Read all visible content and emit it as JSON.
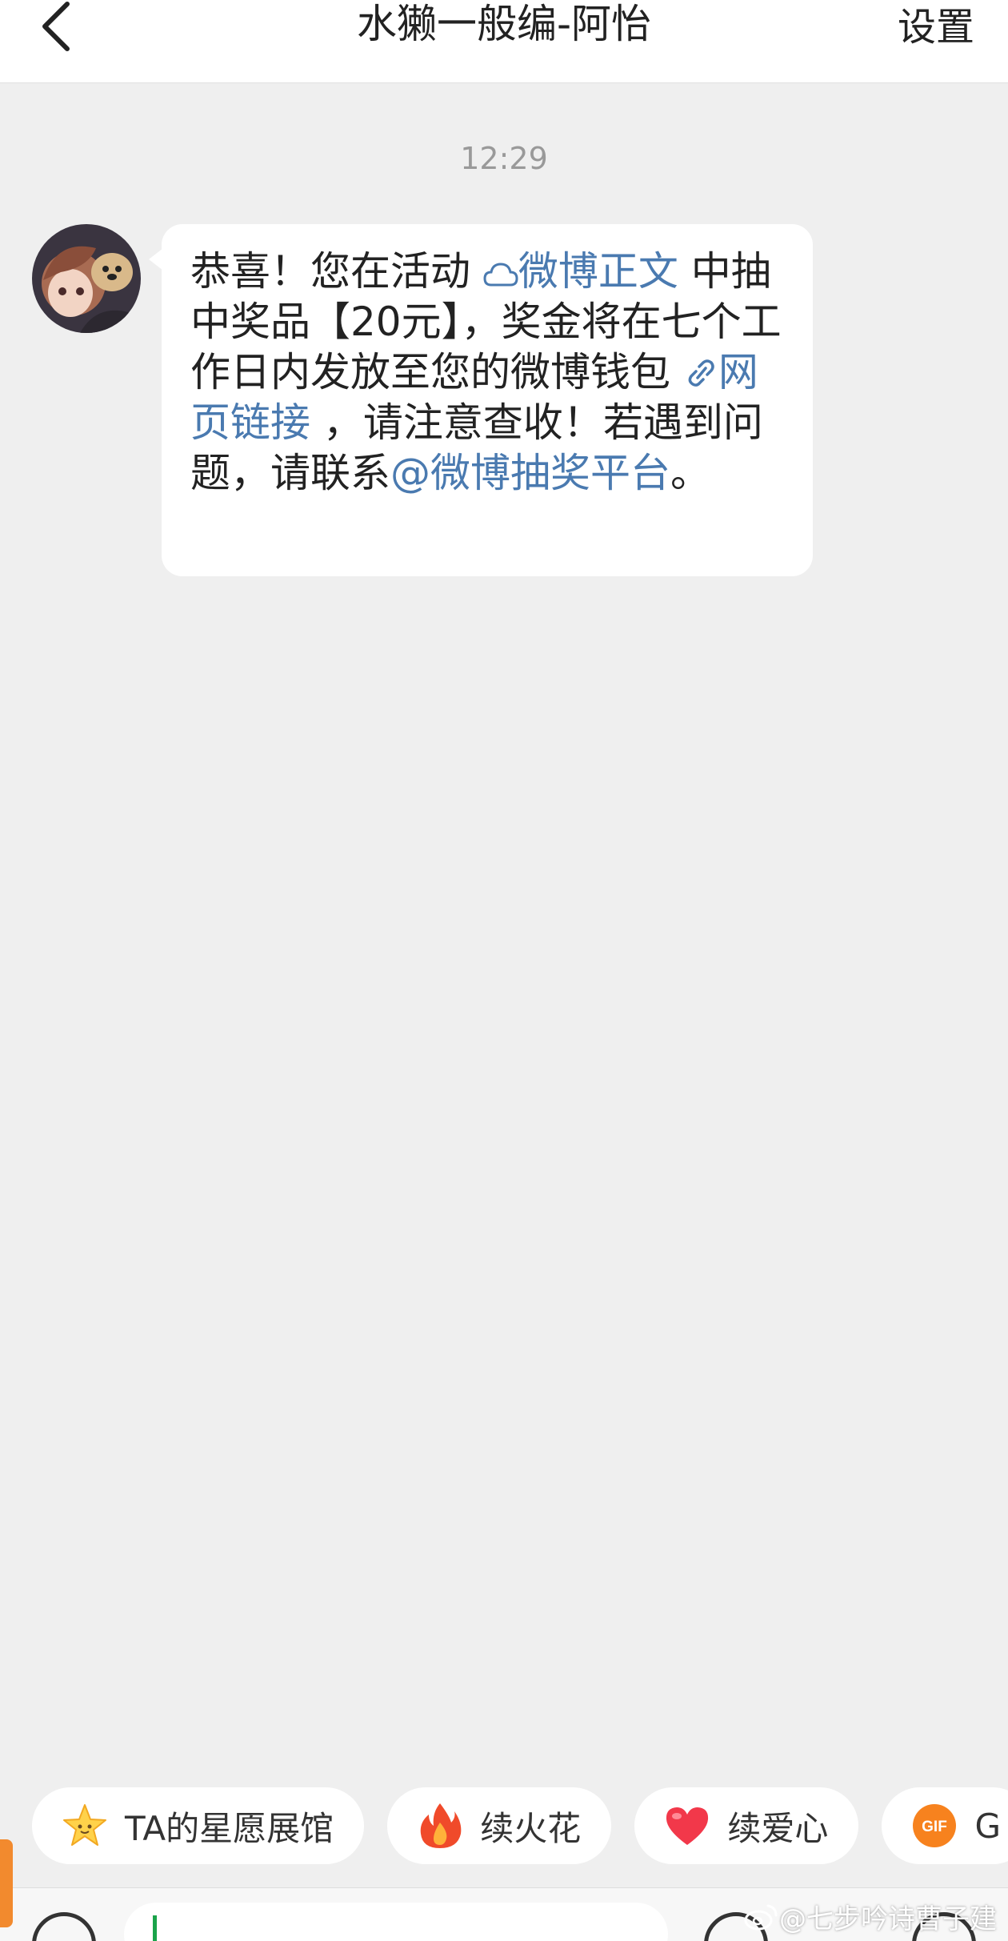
{
  "header": {
    "title": "水獭一般编-阿怡",
    "settings_label": "设置"
  },
  "timestamp": "12:29",
  "message": {
    "p1": "恭喜！您在活动 ",
    "link_post": "微博正文",
    "p2": " 中抽中奖品【20元】，奖金将在七个工作日内发放至您的微博钱包 ",
    "link_web": "网页链接",
    "p3": " ，请注意查收！若遇到问题，请联系",
    "mention": "@微博抽奖平台",
    "p4": "。"
  },
  "chips": [
    {
      "label": "TA的星愿展馆",
      "icon": "star-icon"
    },
    {
      "label": "续火花",
      "icon": "fire-icon"
    },
    {
      "label": "续爱心",
      "icon": "heart-icon"
    },
    {
      "label": "G",
      "icon": "gif-icon",
      "badge": "GIF"
    }
  ],
  "watermark": "@七步吟诗曹子建",
  "colors": {
    "link": "#4a7ab0",
    "background": "#efefef",
    "bubble": "#ffffff",
    "cursor": "#1aa34a"
  }
}
